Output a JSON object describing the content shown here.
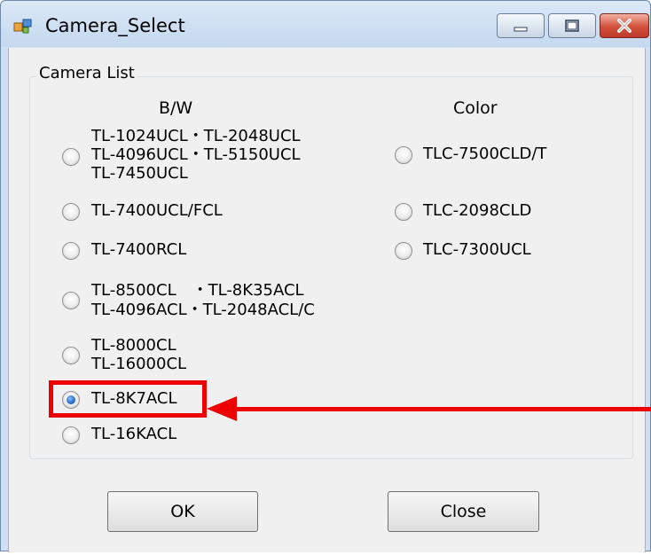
{
  "window": {
    "title": "Camera_Select",
    "title_icon": "app-window-icon"
  },
  "controls": {
    "minimize_icon": "minimize-icon",
    "maximize_icon": "maximize-icon",
    "close_icon": "close-icon"
  },
  "group": {
    "title": "Camera List",
    "bw_header": "B/W",
    "color_header": "Color",
    "bw_options": [
      {
        "lines": [
          "TL-1024UCL・TL-2048UCL",
          "TL-4096UCL・TL-5150UCL",
          "TL-7450UCL"
        ],
        "checked": false
      },
      {
        "lines": [
          "TL-7400UCL/FCL"
        ],
        "checked": false
      },
      {
        "lines": [
          "TL-7400RCL"
        ],
        "checked": false
      },
      {
        "lines": [
          "TL-8500CL　・TL-8K35ACL",
          "TL-4096ACL・TL-2048ACL/C"
        ],
        "checked": false
      },
      {
        "lines": [
          "TL-8000CL",
          "TL-16000CL"
        ],
        "checked": false
      },
      {
        "lines": [
          "TL-8K7ACL"
        ],
        "checked": true
      },
      {
        "lines": [
          "TL-16KACL"
        ],
        "checked": false
      }
    ],
    "color_options": [
      {
        "lines": [
          "TLC-7500CLD/T"
        ],
        "checked": false
      },
      {
        "lines": [
          "TLC-2098CLD"
        ],
        "checked": false
      },
      {
        "lines": [
          "TLC-7300UCL"
        ],
        "checked": false
      }
    ]
  },
  "buttons": {
    "ok": "OK",
    "close": "Close"
  },
  "annotation": {
    "color": "#ee0000"
  }
}
